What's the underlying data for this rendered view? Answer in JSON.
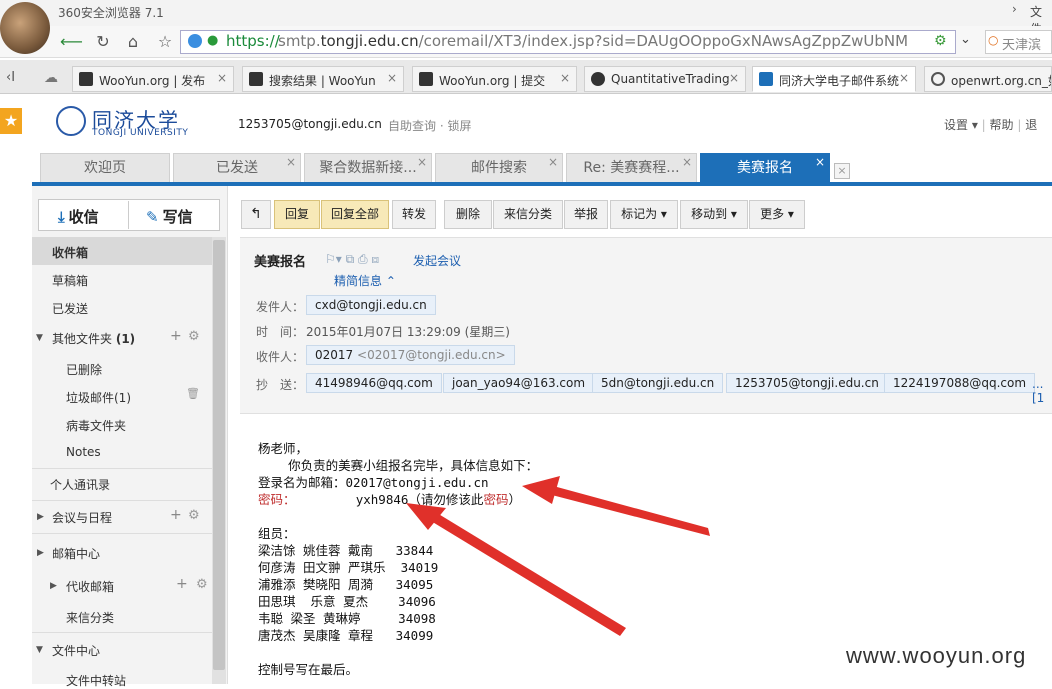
{
  "browser": {
    "title": "360安全浏览器 7.1",
    "file_label": "文件",
    "url_scheme": "https://",
    "url_pre": "smtp.",
    "url_host": "tongji.edu.cn",
    "url_path": "/coremail/XT3/index.jsp?sid=DAUgOOppoGxNAwsAgZppZwUbNM",
    "search_text": "天津滨",
    "tabs": [
      {
        "label": "WooYun.org | 发布"
      },
      {
        "label": "搜索结果 | WooYun"
      },
      {
        "label": "WooYun.org | 提交"
      },
      {
        "label": "QuantitativeTrading"
      },
      {
        "label": "同济大学电子邮件系统"
      },
      {
        "label": "openwrt.org.cn_如"
      }
    ]
  },
  "header": {
    "logo_cn": "同济大学",
    "logo_en": "TONGJI UNIVERSITY",
    "user_email": "1253705@tongji.edu.cn",
    "self_query": "自助查询",
    "dot": "·",
    "lock": "锁屏",
    "settings": "设置",
    "help": "帮助",
    "exit": "退"
  },
  "app_tabs": [
    {
      "label": "欢迎页"
    },
    {
      "label": "已发送"
    },
    {
      "label": "聚合数据新接..."
    },
    {
      "label": "邮件搜索"
    },
    {
      "label": "Re: 美赛赛程..."
    },
    {
      "label": "美赛报名"
    }
  ],
  "sidebar": {
    "receive": "收信",
    "compose": "写信",
    "inbox": "收件箱",
    "drafts": "草稿箱",
    "sent": "已发送",
    "other_folders": "其他文件夹",
    "other_count": "(1)",
    "deleted": "已删除",
    "junk": "垃圾邮件(1)",
    "virus": "病毒文件夹",
    "notes": "Notes",
    "contacts": "个人通讯录",
    "calendar": "会议与日程",
    "mail_center": "邮箱中心",
    "proxy_mail": "代收邮箱",
    "mail_sort": "来信分类",
    "file_center": "文件中心",
    "file_transfer": "文件中转站"
  },
  "toolbar": {
    "back": "↰",
    "reply": "回复",
    "reply_all": "回复全部",
    "forward": "转发",
    "delete": "删除",
    "classify": "来信分类",
    "report": "举报",
    "mark_as": "标记为",
    "move_to": "移动到",
    "more": "更多"
  },
  "mail": {
    "subject": "美赛报名",
    "start_meeting": "发起会议",
    "brief_info": "精简信息",
    "from_label": "发件人：",
    "from": "cxd@tongji.edu.cn",
    "time_label": "时　间：",
    "time": "2015年01月07日 13:29:09 (星期三)",
    "to_label": "收件人：",
    "to_name": "02017",
    "to_addr": "<02017@tongji.edu.cn>",
    "cc_label": "抄　送：",
    "cc": [
      "41498946@qq.com",
      "joan_yao94@163.com",
      "5dn@tongji.edu.cn",
      "1253705@tongji.edu.cn",
      "1224197088@qq.com"
    ],
    "more_cc": "...[1",
    "body": {
      "greeting": "杨老师，",
      "intro": "    你负责的美赛小组报名完毕，具体信息如下：",
      "login_label": "登录名为邮箱：",
      "login_value": "02017@tongji.edu.cn",
      "pwd_label": "密码：",
      "pwd_value": "yxh9846",
      "pwd_note_a": "（请勿修该此",
      "pwd_note_red": "密码",
      "pwd_note_b": "）",
      "members_label": "组员：",
      "members": [
        "梁洁馀 姚佳蓉 戴南   33844",
        "何彦涛 田文翀 严琪乐  34019",
        "浦雅添 樊晓阳 周漪   34095",
        "田思琪  乐意 夏杰    34096",
        "韦聪 梁圣 黄琳婷     34098",
        "唐茂杰 吴康隆 章程   34099"
      ],
      "last_line": "控制号写在最后。"
    }
  },
  "watermark": "www.wooyun.org",
  "colors": {
    "accent": "#1d6fb8",
    "arrow": "#e0302a",
    "toolbar_highlight": "#f7e9b8"
  }
}
